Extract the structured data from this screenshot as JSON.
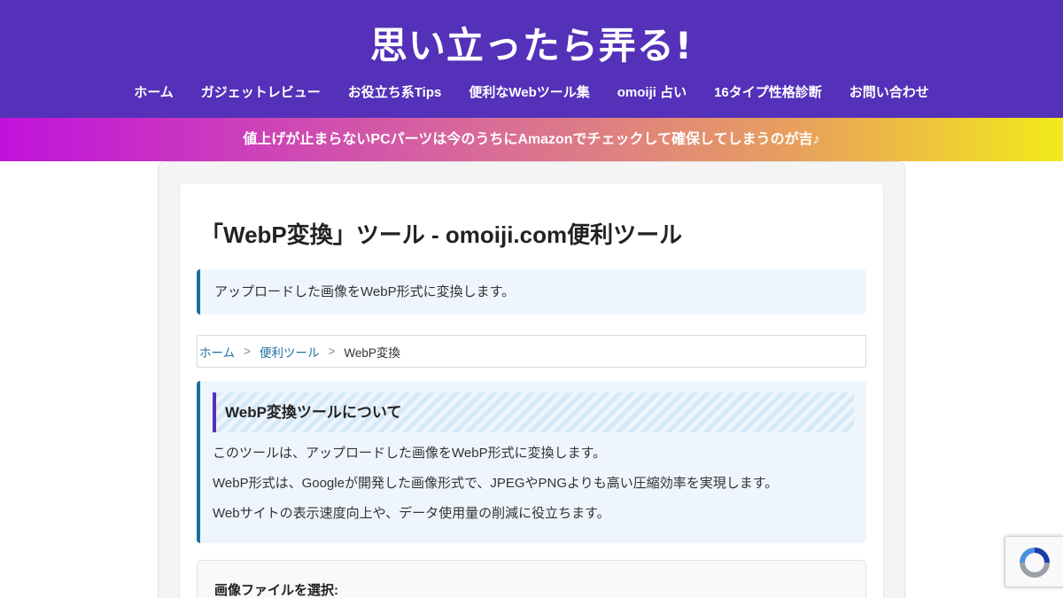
{
  "header": {
    "site_title": "思い立ったら弄る!",
    "nav": [
      {
        "label": "ホーム"
      },
      {
        "label": "ガジェットレビュー"
      },
      {
        "label": "お役立ち系Tips"
      },
      {
        "label": "便利なWebツール集"
      },
      {
        "label": "omoiji 占い"
      },
      {
        "label": "16タイプ性格診断"
      },
      {
        "label": "お問い合わせ"
      }
    ],
    "background_color": "#5431b8"
  },
  "notice": {
    "text": "値上げが止まらないPCパーツは今のうちにAmazonでチェックして確保してしまうのが吉♪"
  },
  "article": {
    "title": "「WebP変換」ツール - omoiji.com便利ツール",
    "description": "アップロードした画像をWebP形式に変換します。",
    "breadcrumb": {
      "home": "ホーム",
      "separator": ">",
      "category": "便利ツール",
      "current": "WebP変換"
    },
    "about": {
      "heading": "WebP変換ツールについて",
      "paragraphs": [
        "このツールは、アップロードした画像をWebP形式に変換します。",
        "WebP形式は、Googleが開発した画像形式で、JPEGやPNGよりも高い圧縮効率を実現します。",
        "Webサイトの表示速度向上や、データ使用量の削減に役立ちます。"
      ]
    },
    "file_input": {
      "label": "画像ファイルを選択:"
    }
  },
  "colors": {
    "accent": "#1a6fa0",
    "heading_bar": "#5431b8",
    "panel_bg": "#eef5fd"
  },
  "icons": {
    "recaptcha": "recaptcha-icon"
  }
}
